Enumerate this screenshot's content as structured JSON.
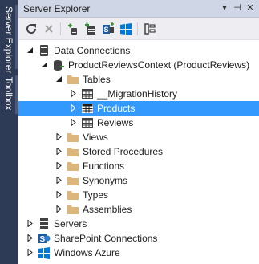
{
  "dock": {
    "tabs": [
      {
        "label": "Server Explorer"
      },
      {
        "label": "Toolbox"
      }
    ]
  },
  "panel": {
    "title": "Server Explorer",
    "controls": {
      "dropdown": "▾",
      "pin": "⊣",
      "close": "✕"
    }
  },
  "toolbar": {
    "buttons": [
      "refresh-icon",
      "stop-icon",
      "connect-to-database-icon",
      "add-connection-icon",
      "sharepoint-icon",
      "windows-azure-icon",
      "properties-icon"
    ]
  },
  "tree": {
    "data_connections": "Data Connections",
    "context": "ProductReviewsContext (ProductReviews)",
    "tables": "Tables",
    "migration_history": "__MigrationHistory",
    "products": "Products",
    "reviews": "Reviews",
    "views": "Views",
    "stored_procedures": "Stored Procedures",
    "functions": "Functions",
    "synonyms": "Synonyms",
    "types": "Types",
    "assemblies": "Assemblies",
    "servers": "Servers",
    "sharepoint": "SharePoint Connections",
    "azure": "Windows Azure"
  },
  "colors": {
    "selection": "#3399ff",
    "folder": "#dcb67a",
    "dock": "#2e3b56"
  }
}
